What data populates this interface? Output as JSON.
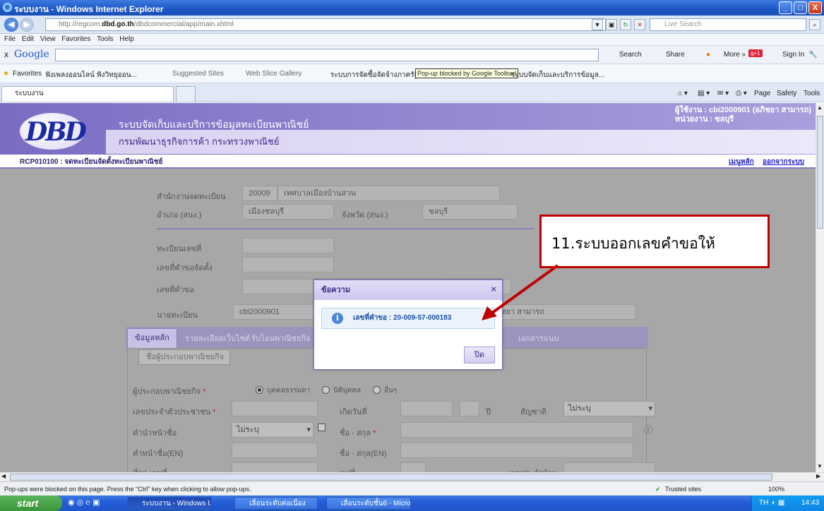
{
  "window": {
    "title": "ระบบงาน - Windows Internet Explorer",
    "min": "_",
    "max": "□",
    "close": "X"
  },
  "address": {
    "url_prefix": "http://regcom.",
    "url_domain": "dbd.go.th",
    "url_path": "/dbdcommercial/app/main.xhtml",
    "live_search_placeholder": "Live Search"
  },
  "menu": [
    "File",
    "Edit",
    "View",
    "Favorites",
    "Tools",
    "Help"
  ],
  "google_bar": {
    "close": "x",
    "logo": "Google",
    "search": "Search",
    "share": "Share",
    "more": "More »",
    "sign_in": "Sign In"
  },
  "favorites_bar": {
    "favorites": "Favorites",
    "item1": "ฟังเพลงออนไลน์ ฟังวิทยุออน...",
    "item2": "Suggested Sites",
    "item3": "Web Slice Gallery",
    "item4": "ระบบการจัดซื้อจัดจ้างภาครัฐ",
    "popup_blocked": "Pop-up blocked by Google Toolbar!",
    "item5": "ระบบจัดเก็บและบริการข้อมูล..."
  },
  "tabs": {
    "active_tab": "ระบบงาน",
    "page": "Page",
    "safety": "Safety",
    "tools": "Tools"
  },
  "app": {
    "logo": "DBD",
    "system_title": "ระบบจัดเก็บและบริการข้อมูลทะเบียนพาณิชย์",
    "department": "กรมพัฒนาธุรกิจการค้า  กระทรวงพาณิชย์",
    "user_line": "ผู้ใช้งาน : cbi2000901 (อภิชยา สามารถ)",
    "unit_line": "หน่วยงาน : ชลบุรี",
    "screen_code": "RCP010100 : จดทะเบียนจัดตั้งทะเบียนพาณิชย์",
    "main_menu": "เมนูหลัก",
    "logout": "ออกจากระบบ"
  },
  "form": {
    "office_label": "สำนักงานจดทะเบียน",
    "office_code": "20009",
    "office_name": "เทศบาลเมืองบ้านสวน",
    "district_label": "อำเภอ (สนง.)",
    "district_value": "เมืองชลบุรี",
    "province_label": "จังหวัด (สนง.)",
    "province_value": "ชลบุรี",
    "reg_no_label": "ทะเบียนเลขที่",
    "req_setup_label": "เลขที่คำขอจัดตั้ง",
    "req_no_label": "เลขที่คำขอ",
    "registrar_label": "นายทะเบียน",
    "registrar_value": "cbi2000901",
    "registrar_name": "ชยา สามารถ",
    "tabs": [
      "ข้อมูลหลัก",
      "รายละเอียดเว็บไซต์",
      "รับโอนพาณิชยกิจ",
      "เอกสารแนบ"
    ],
    "group_title": "ชื่อผู้ประกอบพาณิชยกิจ",
    "operator_label": "ผู้ประกอบพาณิชยกิจ",
    "required_mark": "*",
    "radio_person": "บุคคลธรรมดา",
    "radio_juristic": "นิติบุคคล",
    "radio_other": "อื่นๆ",
    "id_label": "เลขประจำตัวประชาชน",
    "birth_label": "เกิดวันที่",
    "year_label": "ปี",
    "nationality_label": "สัญชาติ",
    "nationality_value": "ไม่ระบุ",
    "prefix_label": "คำนำหน้าชื่อ",
    "prefix_value": "ไม่ระบุ",
    "name_label": "ชื่อ - สกุล",
    "prefix_en_label": "คำหน้าชื่อ(EN)",
    "name_en_label": "ชื่อ - สกุล(EN)",
    "address_label": "ที่อยู่ เลขที่",
    "moo_label": "หมู่ที่",
    "house_id_label": "เลขประจำบ้าน"
  },
  "dialog": {
    "title": "ข้อความ",
    "close": "×",
    "message": "เลขที่คำขอ : 20-009-57-000183",
    "button": "ปิด"
  },
  "callout": {
    "text": "11.ระบบออกเลขคำขอให้",
    "color": "#c00000"
  },
  "status": {
    "text": "Pop-ups were blocked on this page. Press the \"Ctrl\" key when clicking to allow pop-ups.",
    "zone": "Trusted sites",
    "zoom": "100%"
  },
  "taskbar": {
    "start": "start",
    "tasks": [
      "ระบบงาน - Windows I...",
      "เลื่อนระดับต่อเนื่อง",
      "เลื่อนระดับชั้น6 - Micros..."
    ],
    "lang": "TH",
    "time": "14:43"
  }
}
